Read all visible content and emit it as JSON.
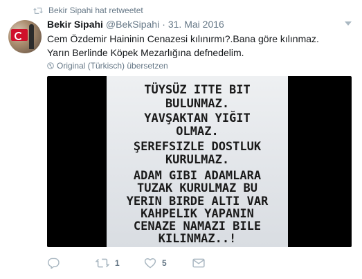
{
  "retweet_context": {
    "text": "Bekir Sipahi hat retweetet",
    "icon": "retweet-icon"
  },
  "author": {
    "name": "Bekir Sipahi",
    "handle": "@BekSipahi",
    "separator": "·",
    "date": "31. Mai 2016"
  },
  "tweet": {
    "line1": "Cem Özdemir Haininin Cenazesi kılınırmı?.Bana göre kılınmaz.",
    "line2": "Yarın Berlinde Köpek Mezarlığına defnedelim."
  },
  "translate": {
    "label": "Original (Türkisch) übersetzen",
    "icon": "globe-icon"
  },
  "media": {
    "lines": [
      "TÜYSÜZ ITTE BIT",
      "BULUNMAZ.",
      "YAVŞAKTAN YIĞIT",
      "OLMAZ.",
      "ŞEREFSIZLE DOSTLUK",
      "KURULMAZ.",
      "ADAM GIBI ADAMLARA",
      "TUZAK KURULMAZ BU",
      "YERIN BIRDE ALTI VAR",
      "KAHPELIK YAPANIN",
      "CENAZE NAMAZI BILE",
      "KILINMAZ..!"
    ]
  },
  "actions": {
    "reply": {
      "icon": "reply-icon",
      "count": ""
    },
    "retweet": {
      "icon": "retweet-icon",
      "count": "1"
    },
    "like": {
      "icon": "heart-icon",
      "count": "5"
    },
    "dm": {
      "icon": "envelope-icon"
    }
  },
  "colors": {
    "secondary_text": "#657786",
    "primary_text": "#14171a",
    "icon_gray": "#aab8c2"
  }
}
